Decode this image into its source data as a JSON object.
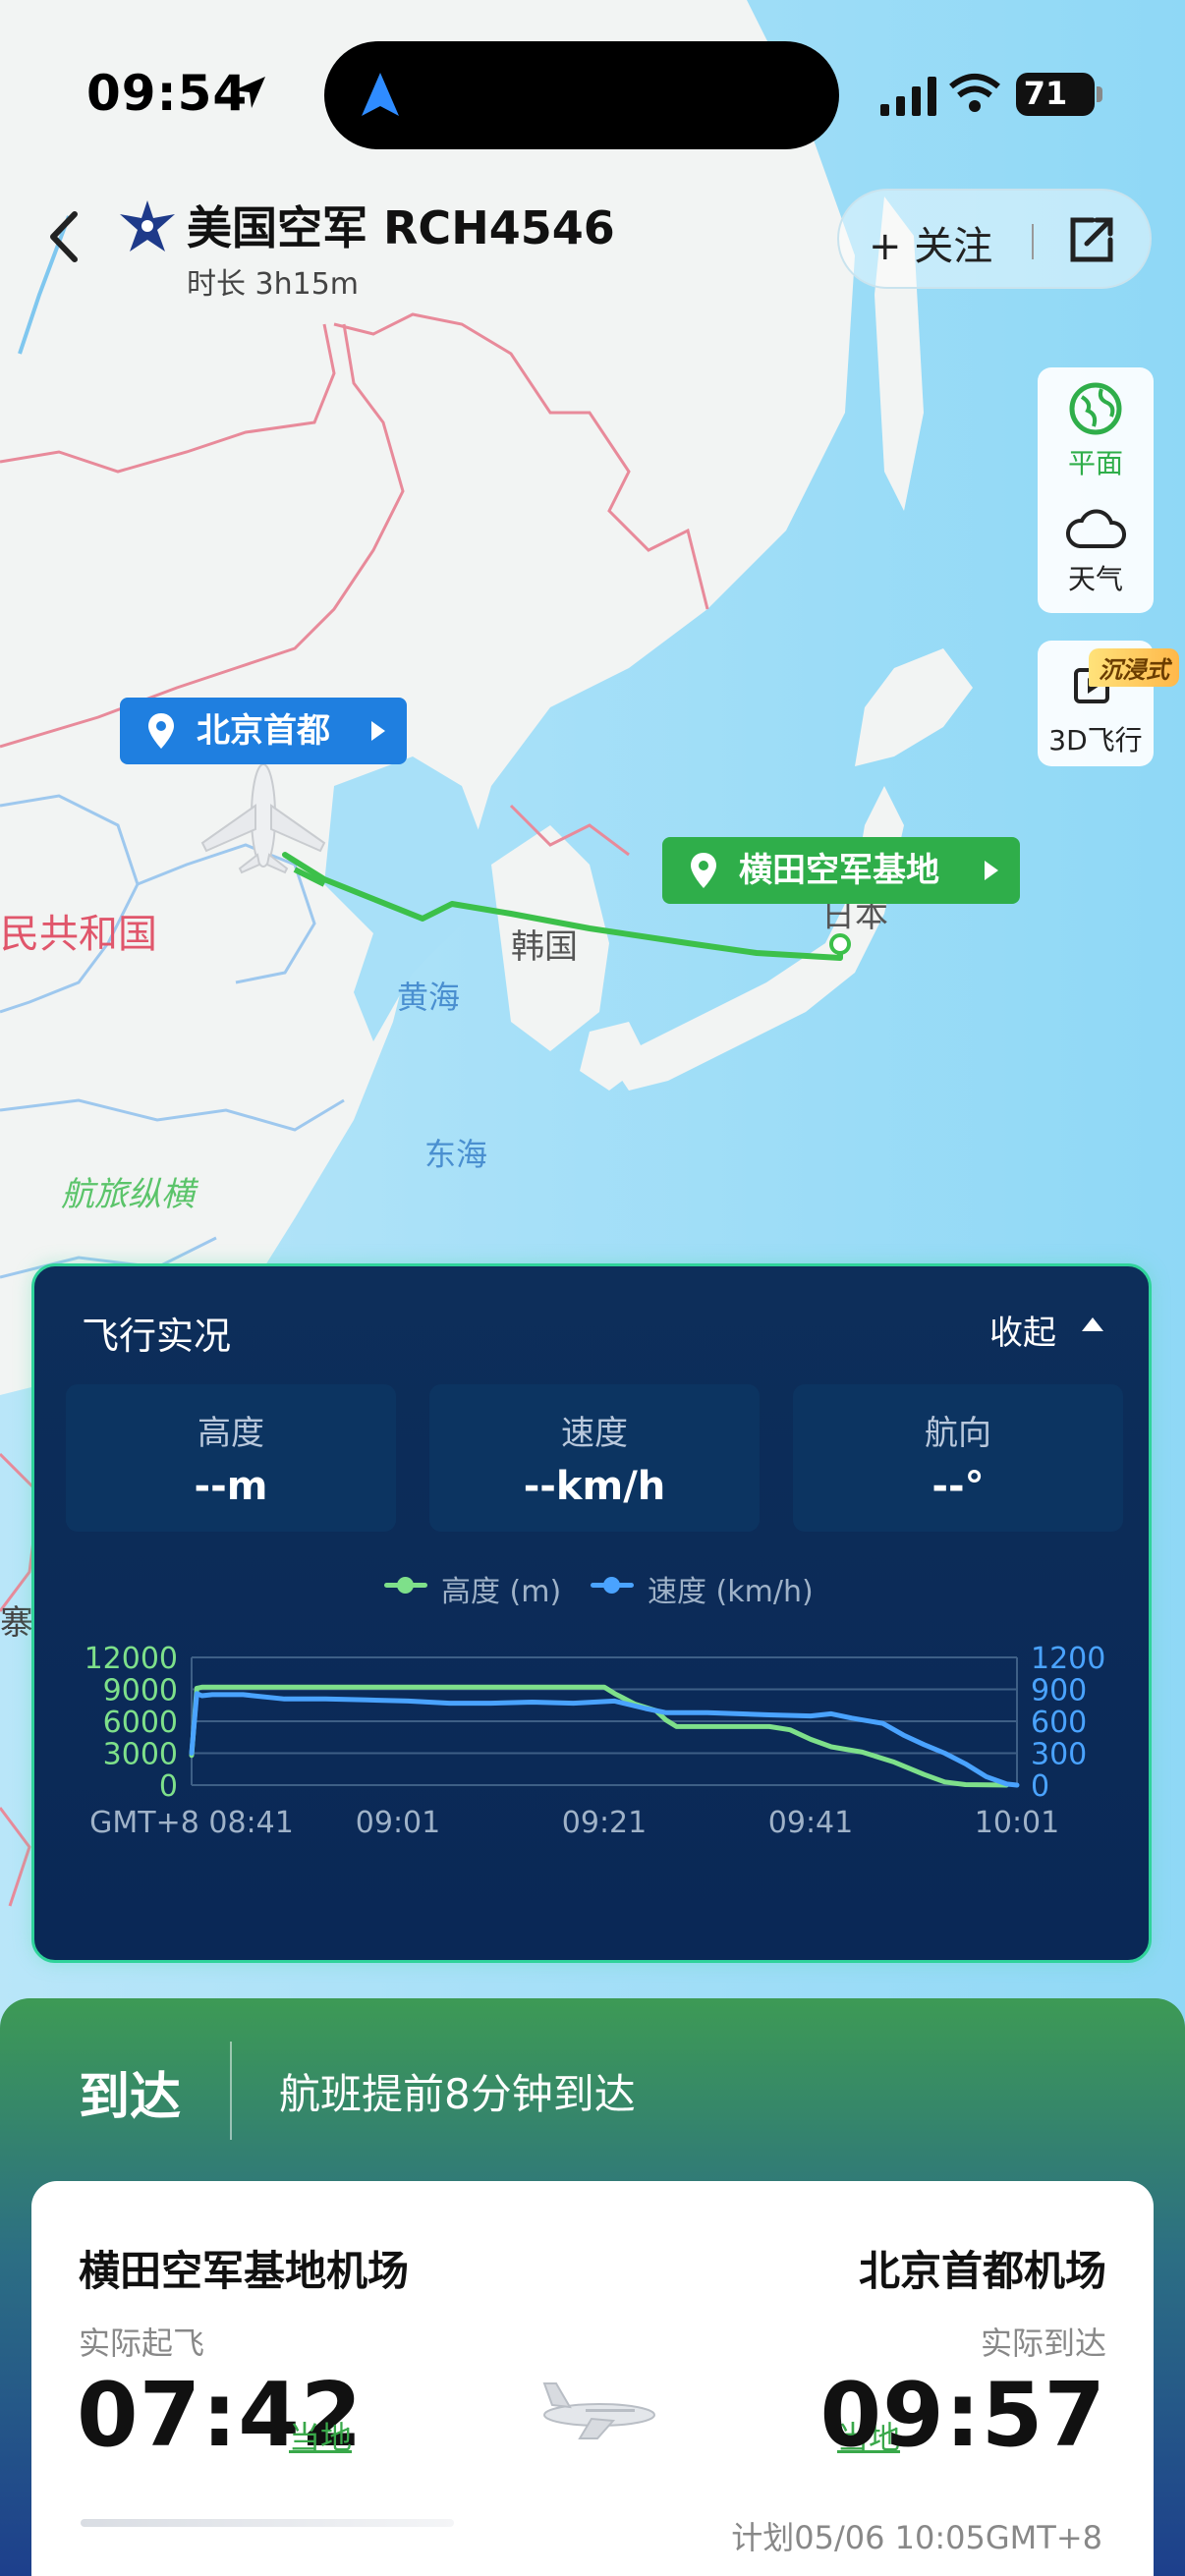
{
  "status_bar": {
    "time": "09:54",
    "battery": "71"
  },
  "header": {
    "back_icon": "chevron-left-icon",
    "title": "美国空军 RCH4546",
    "duration": "时长 3h15m",
    "follow_label": "+ 关注",
    "share_icon": "share-icon"
  },
  "map": {
    "origin_tag": "北京首都",
    "destination_tag": "横田空军基地",
    "labels": {
      "country_cn": "民共和国",
      "korea": "韩国",
      "japan": "日本",
      "yellow_sea": "黄海",
      "east_sea": "东海",
      "watermark": "航旅纵横",
      "left_edge": "寨"
    },
    "route_color": "#3cc04a",
    "origin_tag_color": "#1f7fe0",
    "destination_tag_color": "#2fae4a"
  },
  "tools": {
    "plane_label": "平面",
    "weather_label": "天气",
    "flight3d_label": "3D飞行",
    "immersive_badge": "沉浸式"
  },
  "live": {
    "title": "飞行实况",
    "collapse_label": "收起",
    "altitude_label": "高度",
    "altitude_value": "--m",
    "speed_label": "速度",
    "speed_value": "--km/h",
    "heading_label": "航向",
    "heading_value": "--°"
  },
  "chart_data": {
    "type": "line",
    "x": [
      "GMT+8 08:41",
      "09:01",
      "09:21",
      "09:41",
      "10:01"
    ],
    "x_minutes": [
      0,
      20,
      40,
      60,
      80
    ],
    "series": [
      {
        "name": "高度 (m)",
        "axis": "left",
        "color": "#7ee08a",
        "points": [
          [
            0,
            2800
          ],
          [
            0.5,
            9100
          ],
          [
            1,
            9200
          ],
          [
            40,
            9200
          ],
          [
            41,
            8600
          ],
          [
            43,
            7600
          ],
          [
            45,
            7000
          ],
          [
            46,
            6100
          ],
          [
            47,
            5500
          ],
          [
            56,
            5500
          ],
          [
            58,
            5200
          ],
          [
            60,
            4300
          ],
          [
            62,
            3600
          ],
          [
            65,
            3100
          ],
          [
            68,
            2200
          ],
          [
            71,
            1000
          ],
          [
            73,
            300
          ],
          [
            75,
            50
          ],
          [
            79,
            0
          ]
        ]
      },
      {
        "name": "速度 (km/h)",
        "axis": "right",
        "color": "#4aa3ff",
        "points": [
          [
            0,
            300
          ],
          [
            0.5,
            860
          ],
          [
            1,
            840
          ],
          [
            2,
            850
          ],
          [
            5,
            850
          ],
          [
            9,
            810
          ],
          [
            13,
            810
          ],
          [
            17,
            800
          ],
          [
            21,
            790
          ],
          [
            25,
            770
          ],
          [
            29,
            770
          ],
          [
            33,
            780
          ],
          [
            37,
            770
          ],
          [
            41,
            790
          ],
          [
            44,
            720
          ],
          [
            46,
            680
          ],
          [
            50,
            680
          ],
          [
            56,
            660
          ],
          [
            60,
            650
          ],
          [
            62,
            670
          ],
          [
            64,
            630
          ],
          [
            67,
            580
          ],
          [
            69,
            470
          ],
          [
            71,
            380
          ],
          [
            73,
            300
          ],
          [
            75,
            200
          ],
          [
            77,
            80
          ],
          [
            79,
            10
          ],
          [
            80,
            0
          ]
        ]
      }
    ],
    "ylim_left": [
      0,
      12000
    ],
    "ylim_right": [
      0,
      1200
    ],
    "yticks_left": [
      "12000",
      "9000",
      "6000",
      "3000",
      "0"
    ],
    "yticks_right": [
      "1200",
      "900",
      "600",
      "300",
      "0"
    ],
    "legend": [
      "高度 (m)",
      "速度 (km/h)"
    ],
    "grid": true
  },
  "arrival": {
    "status": "到达",
    "note": "航班提前8分钟到达",
    "origin_airport": "横田空军基地机场",
    "dest_airport": "北京首都机场",
    "takeoff_label": "实际起飞",
    "arrive_label": "实际到达",
    "takeoff_time": "07:42",
    "arrive_time": "09:57",
    "local_label": "当地",
    "plan": "计划05/06 10:05GMT+8"
  }
}
